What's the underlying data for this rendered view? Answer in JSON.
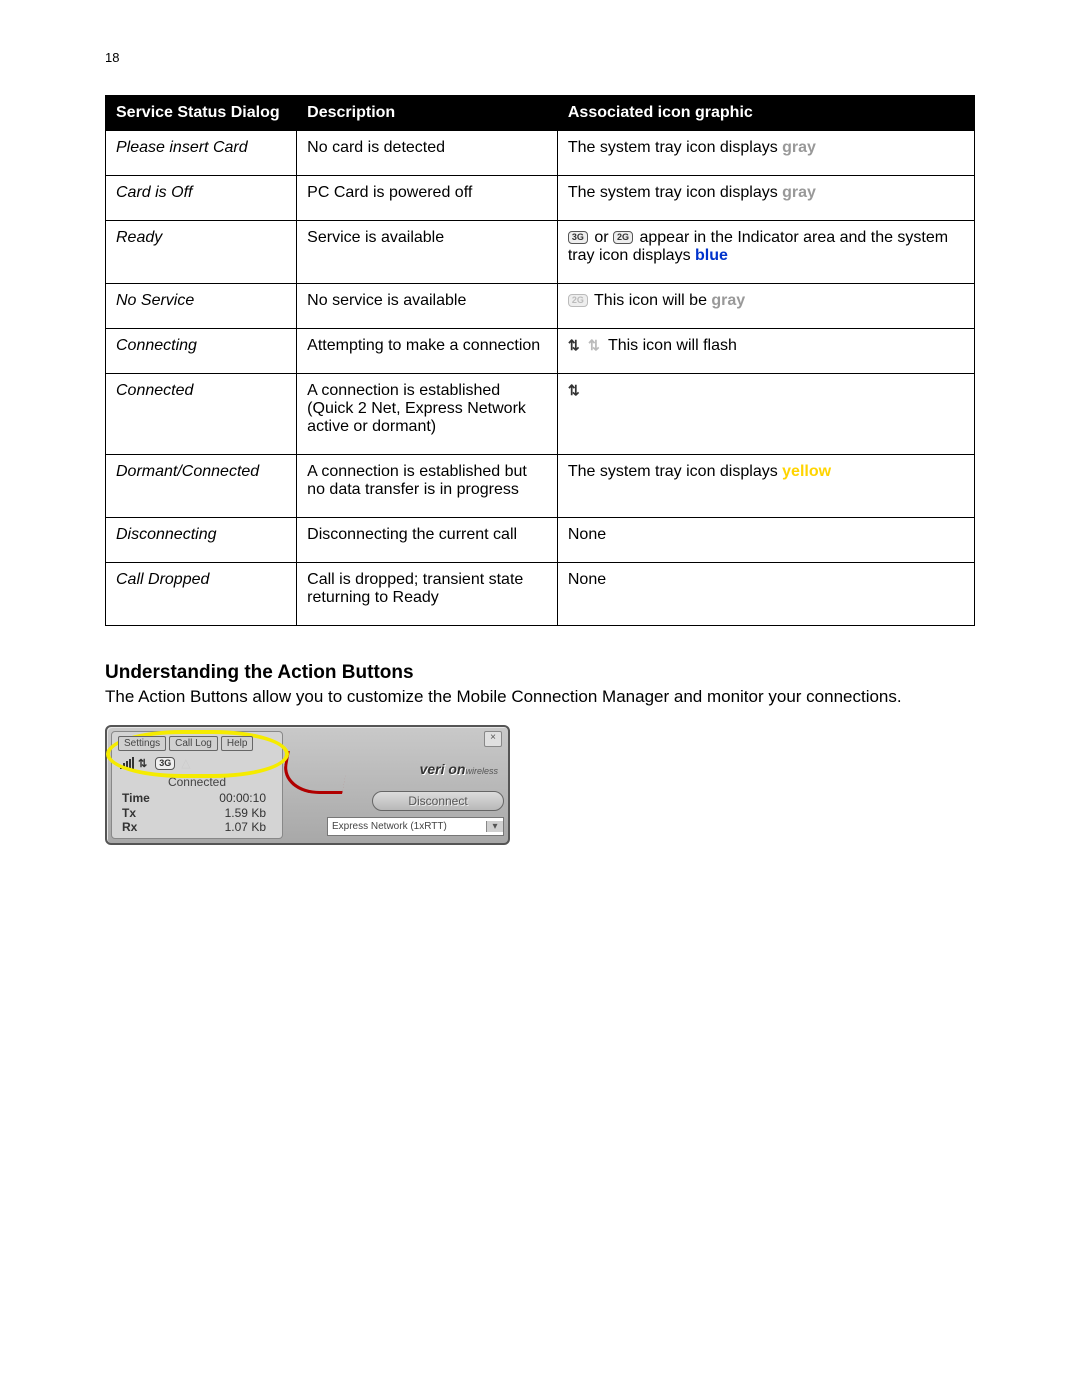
{
  "page_number": "18",
  "table": {
    "headers": {
      "status": "Service Status Dialog",
      "desc": "Description",
      "icon": "Associated icon graphic"
    },
    "rows": [
      {
        "status": "Please insert Card",
        "desc": "No card is detected",
        "icon_pre": "The system tray icon displays ",
        "icon_color_word": "gray",
        "icon_color_class": "gray-word"
      },
      {
        "status": "Card is Off",
        "desc": "PC Card is powered off",
        "icon_pre": "The system tray icon displays ",
        "icon_color_word": "gray",
        "icon_color_class": "gray-word"
      },
      {
        "status": "Ready",
        "desc": "Service is available",
        "icon_ready_mid": " or ",
        "icon_ready_post": " appear in the Indicator area and the system tray icon displays ",
        "icon_color_word": "blue",
        "icon_color_class": "blue-word"
      },
      {
        "status": "No Service",
        "desc": "No service is available",
        "icon_noservice_post": " This icon will be ",
        "icon_color_word": "gray",
        "icon_color_class": "gray-word"
      },
      {
        "status": "Connecting",
        "desc": "Attempting to make a connection",
        "icon_connecting_post": " This icon will flash"
      },
      {
        "status": "Connected",
        "desc": "A connection is established (Quick 2 Net, Express Network active or dormant)",
        "icon_connected_only": true
      },
      {
        "status": "Dormant/Connected",
        "desc": "A connection is established but no data transfer is in progress",
        "icon_pre": "The system tray icon displays ",
        "icon_color_word": "yellow",
        "icon_color_class": "yellow-word"
      },
      {
        "status": "Disconnecting",
        "desc": "Disconnecting the current call",
        "icon_text": "None"
      },
      {
        "status": "Call Dropped",
        "desc": "Call is dropped; transient state returning to Ready",
        "icon_text": "None"
      }
    ]
  },
  "section": {
    "heading": "Understanding the Action Buttons",
    "body": "The Action Buttons allow you to customize the Mobile Connection Manager and monitor your connections."
  },
  "mcm": {
    "buttons": {
      "settings": "Settings",
      "calllog": "Call Log",
      "help": "Help"
    },
    "status": "Connected",
    "stats": {
      "time_k": "Time",
      "time_v": "00:00:10",
      "tx_k": "Tx",
      "tx_v": "1.59 Kb",
      "rx_k": "Rx",
      "rx_v": "1.07 Kb"
    },
    "logo_main": "veri on",
    "logo_sub": "wireless",
    "disconnect": "Disconnect",
    "network": "Express Network (1xRTT)",
    "close": "×",
    "dropdown_glyph": "▾"
  },
  "icon_labels": {
    "g3": "3G",
    "g2": "2G"
  }
}
